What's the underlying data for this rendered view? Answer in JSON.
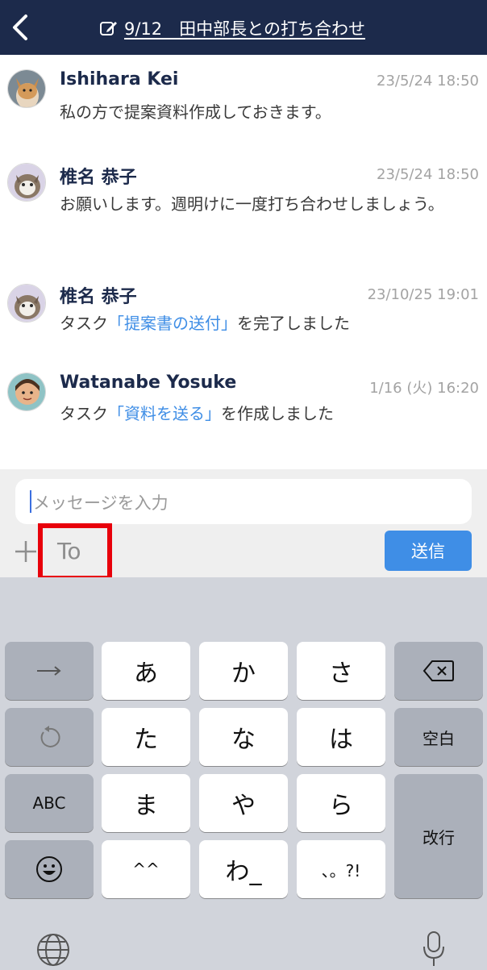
{
  "header": {
    "title": "9/12　田中部長との打ち合わせ",
    "back_icon": "chevron-left-icon",
    "edit_icon": "edit-note-icon",
    "background": "#1c2a4b"
  },
  "messages": [
    {
      "author": "Ishihara Kei",
      "time": "23/5/24 18:50",
      "text": "私の方で提案資料作成しておきます。"
    },
    {
      "author": "椎名 恭子",
      "time": "23/5/24 18:50",
      "text": "お願いします。週明けに一度打ち合わせしましょう。"
    },
    {
      "author": "椎名 恭子",
      "time": "23/10/25 19:01",
      "prefix": "タスク",
      "link": "「提案書の送付」",
      "suffix": "を完了しました"
    },
    {
      "author": "Watanabe Yosuke",
      "time": "1/16 (火) 16:20",
      "prefix": "タスク",
      "link": "「資料を送る」",
      "suffix": "を作成しました"
    }
  ],
  "composer": {
    "placeholder": "メッセージを入力",
    "to_label": "To",
    "send_label": "送信",
    "plus_icon": "plus-icon",
    "accent": "#3f8ee6",
    "highlight": "#e8000b"
  },
  "keyboard": {
    "rows": [
      [
        "→",
        "あ",
        "か",
        "さ",
        "⌫"
      ],
      [
        "↺",
        "た",
        "な",
        "は",
        "空白"
      ],
      [
        "ABC",
        "ま",
        "や",
        "ら",
        "改行"
      ],
      [
        "☺",
        "^^",
        "わ_",
        "、。?!"
      ]
    ],
    "globe_icon": "globe-icon",
    "mic_icon": "microphone-icon"
  }
}
